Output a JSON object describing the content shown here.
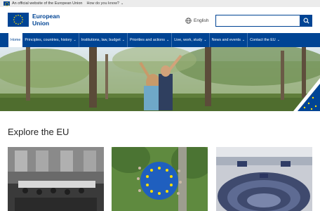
{
  "topbar": {
    "official_text": "An official website of the European Union",
    "how_text": "How do you know?"
  },
  "header": {
    "logo_line1": "European",
    "logo_line2": "Union",
    "language": "English",
    "search_placeholder": ""
  },
  "nav": {
    "items": [
      {
        "label": "Home"
      },
      {
        "label": "Principles, countries, history"
      },
      {
        "label": "Institutions, law, budget"
      },
      {
        "label": "Priorities and actions"
      },
      {
        "label": "Live, work, study"
      },
      {
        "label": "News and events"
      },
      {
        "label": "Contact the EU"
      }
    ]
  },
  "main": {
    "section_title": "Explore the EU"
  },
  "colors": {
    "brand": "#004494",
    "star": "#ffde00"
  }
}
